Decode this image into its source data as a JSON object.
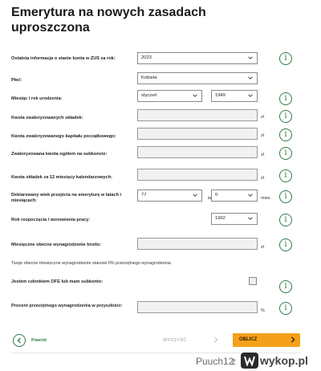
{
  "page": {
    "title": "Emerytura na nowych zasadach uproszczona"
  },
  "form": {
    "zus_year": {
      "label": "Ostatnia informacja o stanie konta w ZUS za rok:",
      "value": "2023"
    },
    "sex": {
      "label": "Płeć:",
      "value": "Kobieta"
    },
    "birth": {
      "label": "Miesiąc i rok urodzenia:",
      "month": "styczeń",
      "year": "1949"
    },
    "contributions": {
      "label": "Kwota zwaloryzowanych składek:",
      "unit": "zł"
    },
    "initial_capital": {
      "label": "Kwota zwaloryzowanego kapitału początkowego:",
      "unit": "zł"
    },
    "subaccount": {
      "label": "Zwaloryzowana kwota ogółem na subkoncie:",
      "unit": "zł"
    },
    "last_12_months": {
      "label": "Kwota składek za 12 miesięcy kalendarzowych:",
      "unit": "zł"
    },
    "retirement_age": {
      "label": "Deklarowany wiek przejścia na emeryturę w latach i miesiącach:",
      "years": "77",
      "years_unit": "lat",
      "months": "0",
      "months_unit": "mies."
    },
    "start_year": {
      "label": "Rok rozpoczęcia / wznowienia pracy:",
      "value": "1962"
    },
    "gross_salary": {
      "label": "Miesięczne obecne wynagrodzenie brutto:",
      "unit": "zł"
    },
    "salary_note": "Twoje obecne miesięczne wynagrodzenie stanowi 0% przeciętnego wynagrodzenia.",
    "ofe": {
      "label": "Jestem członkiem OFE lub mam subkonto:"
    },
    "future_percent": {
      "label": "Procent przeciętnego wynagrodzenia w przyszłości:",
      "unit": "%"
    }
  },
  "footer": {
    "back_label": "Powrót",
    "clear_label": "WYCZYŚĆ",
    "calculate_label": "OBLICZ"
  },
  "watermark": {
    "user": "Puuch12",
    "connector": "z",
    "site": "wykop.pl"
  },
  "icons": {
    "info_glyph": "i"
  },
  "colors": {
    "accent_green": "#2f7d43",
    "button_orange": "#f5a01a"
  }
}
